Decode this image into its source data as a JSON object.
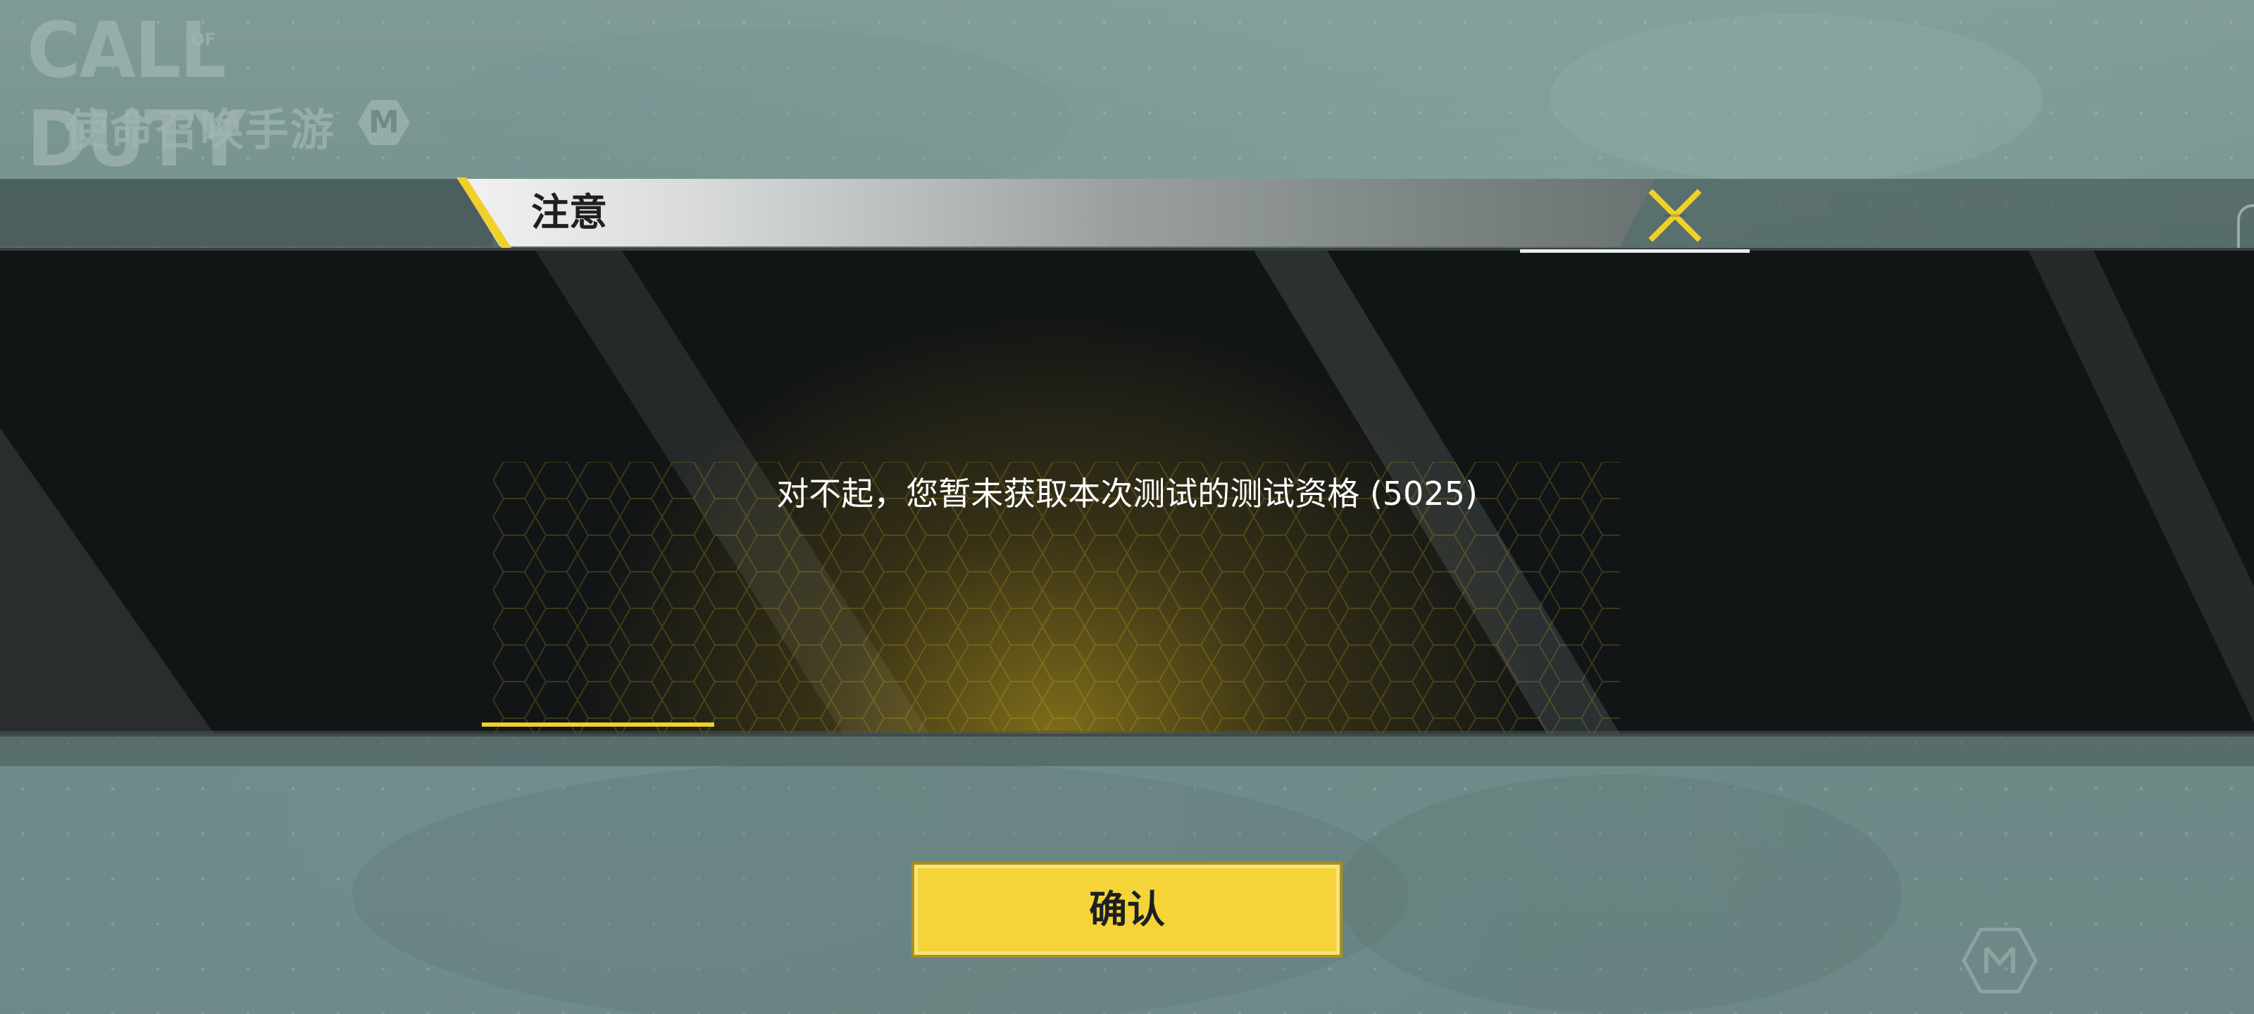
{
  "logo": {
    "main": "CALL DUTY",
    "of": "OF",
    "subtitle": "使命召唤手游",
    "badge": "M"
  },
  "dialog": {
    "title": "注意",
    "message": "对不起，您暂未获取本次测试的测试资格 (5025)",
    "confirm_label": "确认"
  },
  "colors": {
    "accent": "#f1d02a",
    "button": "#f5d43a",
    "panel": "#121516",
    "background": "#6f8c89"
  },
  "icons": {
    "close": "close-icon",
    "hud": "hud-hexagon-icon"
  }
}
